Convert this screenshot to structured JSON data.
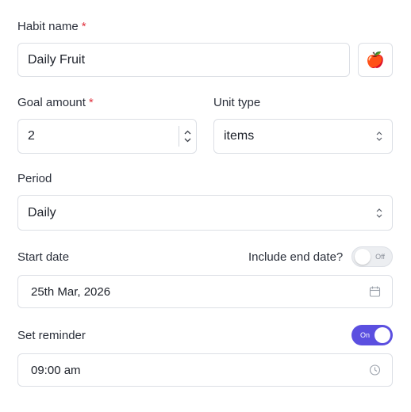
{
  "habit_name": {
    "label": "Habit name",
    "required_mark": "*",
    "value": "Daily Fruit",
    "icon": "red-apple-emoji",
    "icon_glyph": "🍎"
  },
  "goal_amount": {
    "label": "Goal amount",
    "required_mark": "*",
    "value": "2"
  },
  "unit_type": {
    "label": "Unit type",
    "value": "items"
  },
  "period": {
    "label": "Period",
    "value": "Daily"
  },
  "start_date": {
    "label": "Start date",
    "value": "25th Mar, 2026"
  },
  "include_end_date": {
    "label": "Include end date?",
    "toggle_text": "Off"
  },
  "reminder": {
    "label": "Set reminder",
    "toggle_text": "On",
    "value": "09:00 am"
  },
  "colors": {
    "accent": "#5b4fe0",
    "required": "#e0323f",
    "border": "#dcdfe5"
  }
}
